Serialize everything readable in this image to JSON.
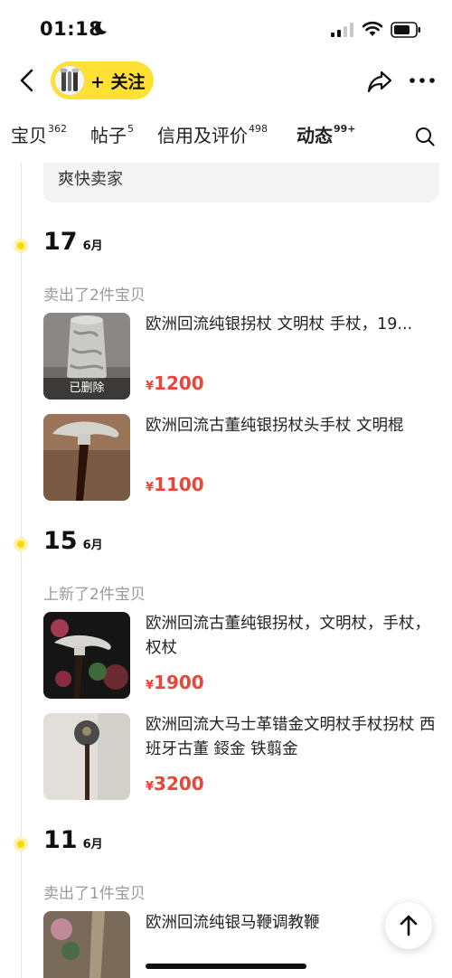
{
  "status_bar": {
    "time": "01:18"
  },
  "nav": {
    "follow_label": "+ 关注"
  },
  "tabs": [
    {
      "label": "宝贝",
      "count": "362"
    },
    {
      "label": "帖子",
      "count": "5"
    },
    {
      "label": "信用及评价",
      "count": "498"
    },
    {
      "label": "动态",
      "count": "99+",
      "active": true
    }
  ],
  "review_snippet": "爽快卖家",
  "timeline": [
    {
      "day": "17",
      "month": "6月",
      "label": "卖出了2件宝贝",
      "items": [
        {
          "title": "欧洲回流纯银拐杖 文明杖 手杖，19...",
          "currency": "¥",
          "price": "1200",
          "badge": "已删除"
        },
        {
          "title": "欧洲回流古董纯银拐杖头手杖 文明棍",
          "currency": "¥",
          "price": "1100"
        }
      ]
    },
    {
      "day": "15",
      "month": "6月",
      "label": "上新了2件宝贝",
      "items": [
        {
          "title": "欧洲回流古董纯银拐杖，文明杖，手杖，权杖",
          "currency": "¥",
          "price": "1900"
        },
        {
          "title": "欧洲回流大马士革错金文明杖手杖拐杖 西班牙古董 鋄金 铁翦金",
          "currency": "¥",
          "price": "3200"
        }
      ]
    },
    {
      "day": "11",
      "month": "6月",
      "label": "卖出了1件宝贝",
      "items": [
        {
          "title": "欧洲回流纯银马鞭调教鞭"
        }
      ]
    }
  ],
  "colors": {
    "accent_yellow": "#ffe033",
    "price_red": "#e8463a",
    "muted_gray": "#9a9a9a"
  },
  "icons": [
    "moon-icon",
    "signal-icon",
    "wifi-icon",
    "battery-icon",
    "back-icon",
    "share-icon",
    "more-icon",
    "search-icon",
    "arrow-up-icon"
  ]
}
